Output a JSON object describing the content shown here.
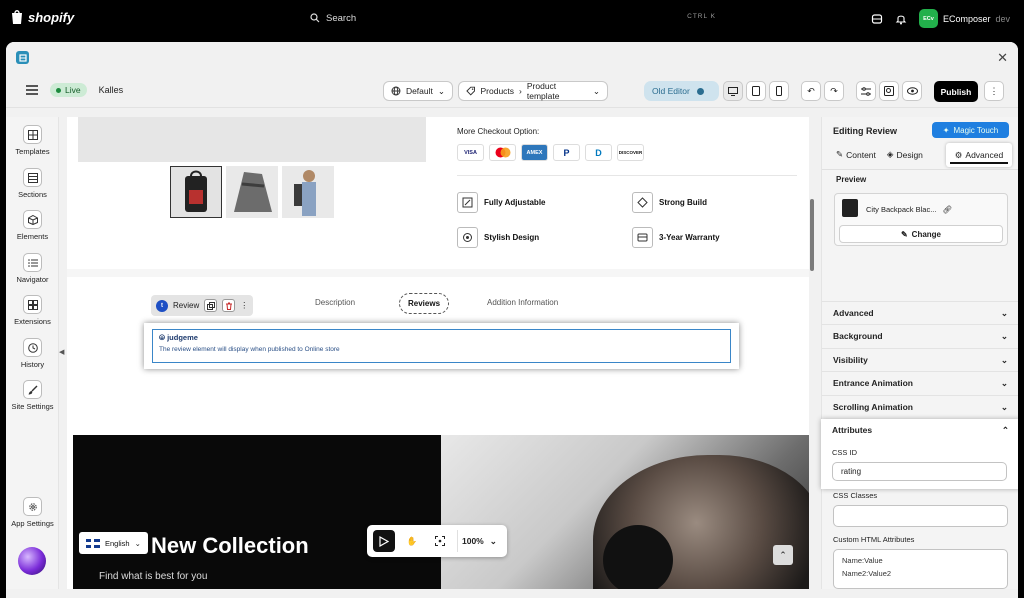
{
  "topbar": {
    "brand": "shopify",
    "search_placeholder": "Search",
    "shortcut": "CTRL K",
    "avatar_initials": "ECv",
    "store_name": "EComposer",
    "store_tag": "dev"
  },
  "toolbar": {
    "live_label": "Live",
    "theme_name": "Kalles",
    "language_select": "Default",
    "breadcrumb_1": "Products",
    "breadcrumb_2": "Product template",
    "old_editor_label": "Old Editor",
    "publish_label": "Publish"
  },
  "sidebar": {
    "items": [
      {
        "label": "Templates"
      },
      {
        "label": "Sections"
      },
      {
        "label": "Elements"
      },
      {
        "label": "Navigator"
      },
      {
        "label": "Extensions"
      },
      {
        "label": "History"
      },
      {
        "label": "Site Settings"
      },
      {
        "label": "App Settings"
      }
    ]
  },
  "canvas": {
    "checkout_title": "More Checkout Option:",
    "payments": [
      "VISA",
      "MC",
      "AMEX",
      "P",
      "D",
      "DISCOVER"
    ],
    "features": [
      {
        "label": "Fully Adjustable"
      },
      {
        "label": "Strong Build"
      },
      {
        "label": "Stylish Design"
      },
      {
        "label": "3-Year Warranty"
      }
    ],
    "review_chip_label": "Review",
    "review_chip_avatar": "t",
    "tabs": [
      {
        "label": "Description"
      },
      {
        "label": "Reviews"
      },
      {
        "label": "Addition Information"
      }
    ],
    "judgeme_title": "judgeme",
    "judgeme_note": "The review element will display when published to Online store",
    "hero_title": "New Collection",
    "hero_subtitle": "Find what is best for you",
    "language": "English"
  },
  "zoom": {
    "level": "100%"
  },
  "panel": {
    "title": "Editing Review",
    "magic_touch": "Magic Touch",
    "tabs": [
      {
        "label": "Content"
      },
      {
        "label": "Design"
      },
      {
        "label": "Advanced"
      }
    ],
    "preview_label": "Preview",
    "product_name": "City Backpack Blac...",
    "change_label": "Change",
    "sections": [
      {
        "label": "Advanced"
      },
      {
        "label": "Background"
      },
      {
        "label": "Visibility"
      },
      {
        "label": "Entrance Animation"
      },
      {
        "label": "Scrolling Animation"
      }
    ],
    "attributes": {
      "label": "Attributes",
      "css_id_label": "CSS ID",
      "css_id_value": "rating",
      "css_classes_label": "CSS Classes",
      "custom_html_label": "Custom HTML Attributes",
      "custom_html_lines": [
        "Name:Value",
        "Name2:Value2"
      ]
    }
  },
  "colors": {
    "brand_green": "#22b04b",
    "publish_bg": "#000000",
    "magic_touch_bg": "#1f7fe0",
    "live_bg": "#cdebd5",
    "old_editor_bg": "#cfe3ee"
  }
}
